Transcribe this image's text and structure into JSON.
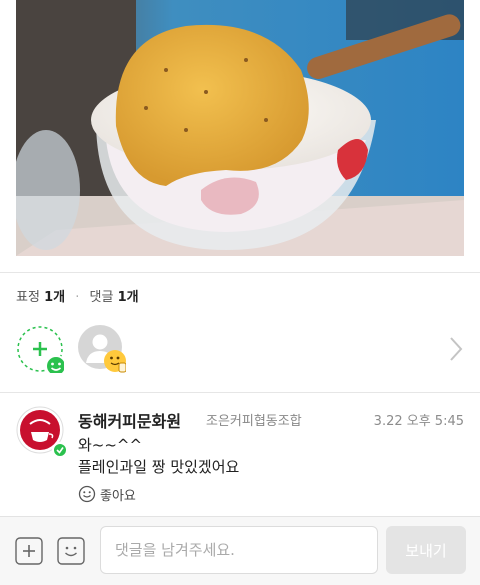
{
  "post": {
    "image_alt": "Dessert in a glass cup with a cracker chip and wooden spoon",
    "reaction_label": "표정",
    "reaction_count": "1개",
    "comment_label": "댓글",
    "comment_count": "1개",
    "separator": "·"
  },
  "reactions": {
    "add_icon": "add-reaction-icon",
    "reactor_icon": "thumbs-up-emoji-icon"
  },
  "comment": {
    "author": "동해커피문화원",
    "organization": "조은커피협동조합",
    "time": "3.22 오후 5:45",
    "line1": "와~~^^",
    "line2": "플레인과일 짱 맛있겠어요",
    "like_label": "좋아요"
  },
  "compose": {
    "placeholder": "댓글을 남겨주세요.",
    "send_label": "보내기"
  },
  "colors": {
    "accent_green": "#2bc14e",
    "logo_red": "#c8102e",
    "send_disabled": "#e4e4e4"
  }
}
